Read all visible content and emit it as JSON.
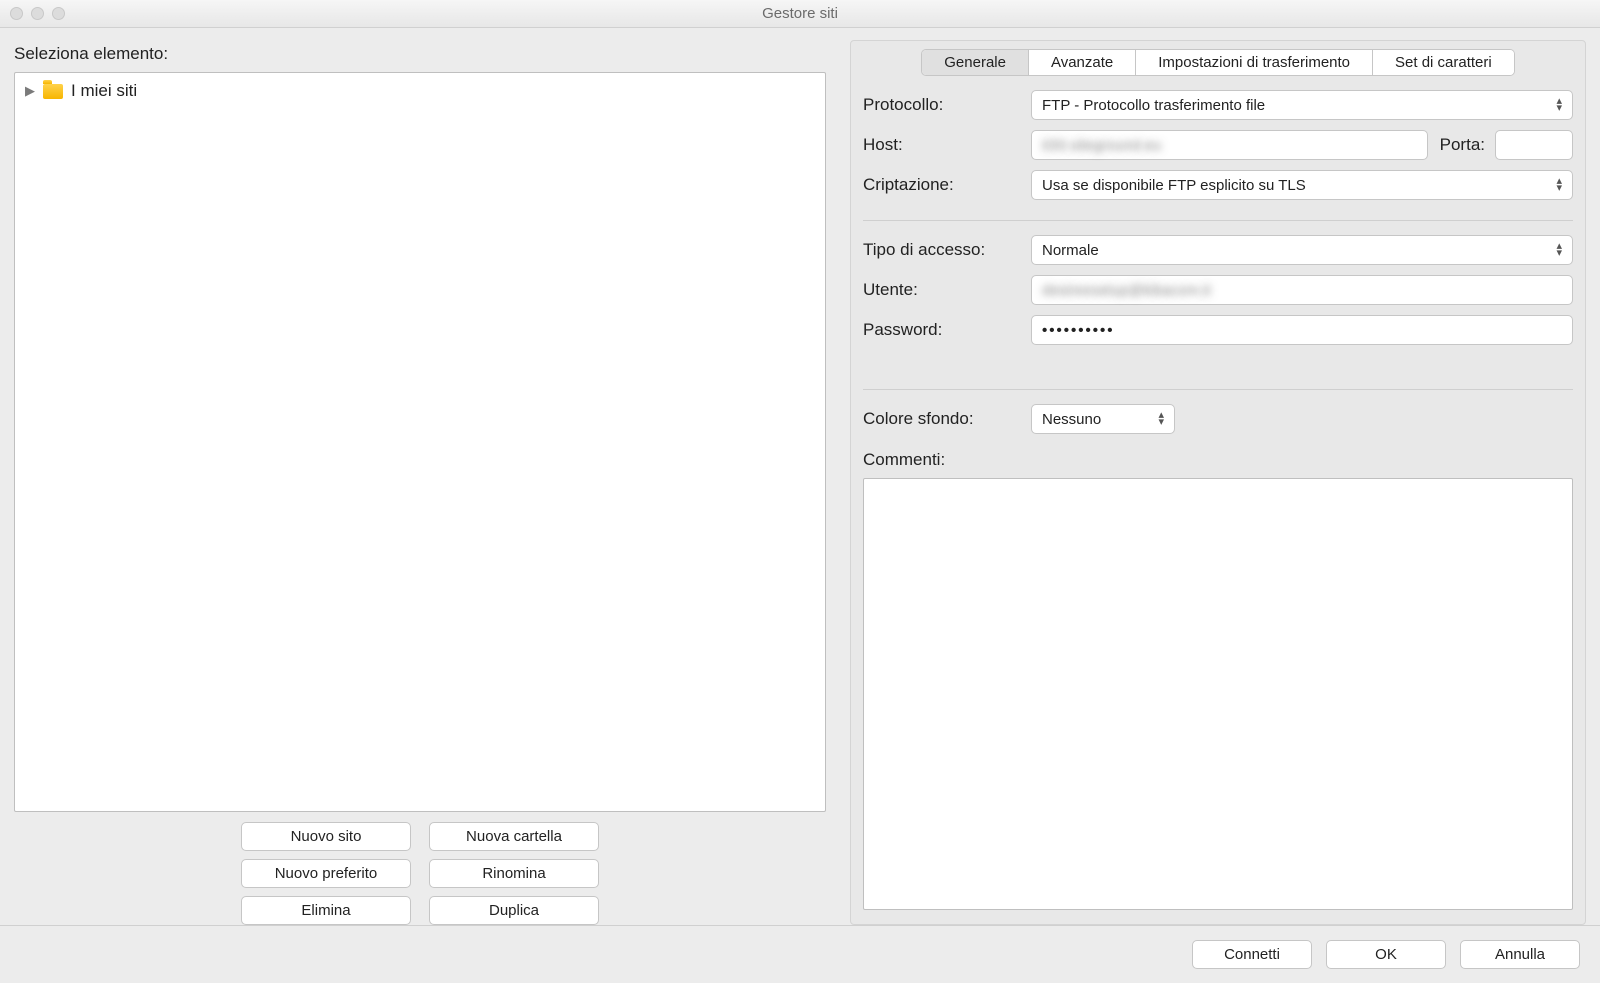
{
  "window": {
    "title": "Gestore siti"
  },
  "left": {
    "heading": "Seleziona elemento:",
    "root_folder": "I miei siti",
    "buttons": {
      "new_site": "Nuovo sito",
      "new_folder": "Nuova cartella",
      "new_bookmark": "Nuovo preferito",
      "rename": "Rinomina",
      "delete": "Elimina",
      "duplicate": "Duplica"
    }
  },
  "tabs": {
    "general": "Generale",
    "advanced": "Avanzate",
    "transfer": "Impostazioni di trasferimento",
    "charset": "Set di caratteri"
  },
  "form": {
    "protocol_label": "Protocollo:",
    "protocol_value": "FTP - Protocollo trasferimento file",
    "host_label": "Host:",
    "host_value": "it30.siteground.eu",
    "port_label": "Porta:",
    "port_value": "",
    "encryption_label": "Criptazione:",
    "encryption_value": "Usa se disponibile FTP esplicito su TLS",
    "logon_label": "Tipo di accesso:",
    "logon_value": "Normale",
    "user_label": "Utente:",
    "user_value": "desireesetup@kibacom.it",
    "password_label": "Password:",
    "password_value": "••••••••••",
    "bgcolor_label": "Colore sfondo:",
    "bgcolor_value": "Nessuno",
    "comments_label": "Commenti:",
    "comments_value": ""
  },
  "footer": {
    "connect": "Connetti",
    "ok": "OK",
    "cancel": "Annulla"
  }
}
